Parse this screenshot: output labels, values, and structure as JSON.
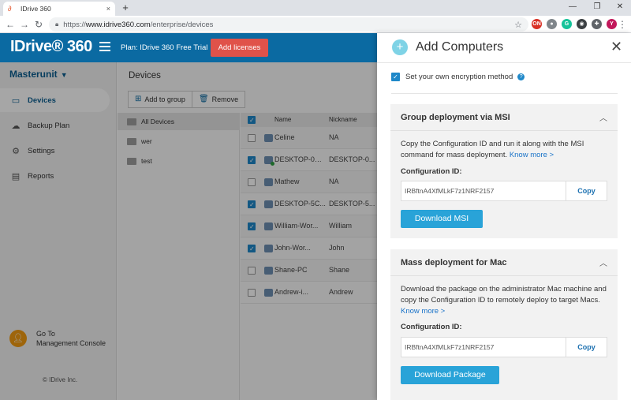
{
  "browser": {
    "tab_title": "IDrive 360",
    "tab_close": "×",
    "new_tab": "+",
    "url_scheme": "https://",
    "url_host": "www.idrive360.com",
    "url_path": "/enterprise/devices",
    "extensions": [
      {
        "name": "ext-red-icon",
        "label": "ON",
        "color": "#d93025"
      },
      {
        "name": "ext-gray-icon",
        "label": "●",
        "color": "#80868b"
      },
      {
        "name": "ext-grammarly-icon",
        "label": "G",
        "color": "#15c39a"
      },
      {
        "name": "ext-dark-icon",
        "label": "◉",
        "color": "#3c4043"
      },
      {
        "name": "ext-puzzle-icon",
        "label": "✚",
        "color": "#5f6368"
      },
      {
        "name": "profile-avatar-icon",
        "label": "Y",
        "color": "#c2185b"
      }
    ]
  },
  "header": {
    "logo": "IDrive® 360",
    "plan": "Plan: IDrive 360 Free Trial",
    "add_licenses": "Add licenses"
  },
  "sidebar": {
    "account": "Masterunit",
    "items": [
      {
        "label": "Devices",
        "icon": "monitor-icon",
        "glyph": "▭",
        "active": true
      },
      {
        "label": "Backup Plan",
        "icon": "cloud-upload-icon",
        "glyph": "☁",
        "active": false
      },
      {
        "label": "Settings",
        "icon": "gear-icon",
        "glyph": "⚙",
        "active": false
      },
      {
        "label": "Reports",
        "icon": "document-icon",
        "glyph": "▤",
        "active": false
      }
    ],
    "console_line1": "Go To",
    "console_line2": "Management Console",
    "copyright": "© IDrive Inc."
  },
  "devices": {
    "title": "Devices",
    "add_to_group": "Add to group",
    "remove": "Remove",
    "groups": [
      "All Devices",
      "wer",
      "test"
    ],
    "col_name": "Name",
    "col_nickname": "Nickname",
    "rows": [
      {
        "name": "Celine",
        "nickname": "NA",
        "checked": false,
        "online": false
      },
      {
        "name": "DESKTOP-0O...",
        "nickname": "DESKTOP-0...",
        "checked": true,
        "online": true
      },
      {
        "name": "Mathew",
        "nickname": "NA",
        "checked": false,
        "online": false
      },
      {
        "name": "DESKTOP-5C...",
        "nickname": "DESKTOP-5...",
        "checked": true,
        "online": false
      },
      {
        "name": "William-Wor...",
        "nickname": "William",
        "checked": true,
        "online": false
      },
      {
        "name": "John-Wor...",
        "nickname": "John",
        "checked": true,
        "online": false
      },
      {
        "name": "Shane-PC",
        "nickname": "Shane",
        "checked": false,
        "online": false
      },
      {
        "name": "Andrew-i...",
        "nickname": "Andrew",
        "checked": false,
        "online": false
      }
    ]
  },
  "panel": {
    "title": "Add Computers",
    "encryption": "Set your own encryption method",
    "msi": {
      "title": "Group deployment via MSI",
      "desc": "Copy the Configuration ID and run it along with the MSI command for mass deployment.",
      "know_more": "Know more >",
      "cfg_label": "Configuration ID:",
      "cfg_value": "IRBftnA4XfMLkF7z1NRF2157",
      "copy": "Copy",
      "download": "Download MSI"
    },
    "mac": {
      "title": "Mass deployment for Mac",
      "desc": "Download the package on the administrator Mac machine and copy the Configuration ID to remotely deploy to target Macs.",
      "know_more": "Know more >",
      "cfg_label": "Configuration ID:",
      "cfg_value": "IRBftnA4XfMLkF7z1NRF2157",
      "copy": "Copy",
      "download": "Download Package"
    }
  }
}
